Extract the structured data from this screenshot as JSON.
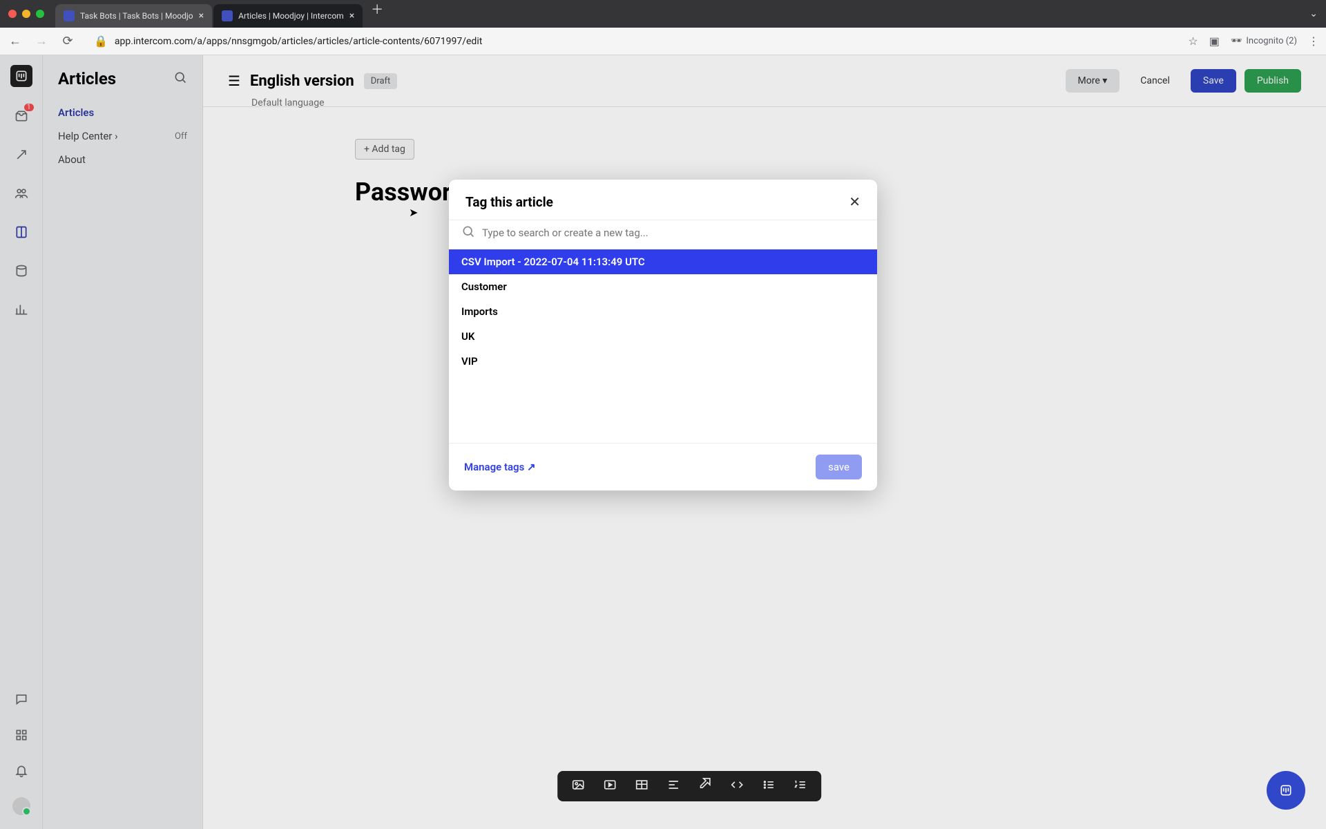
{
  "browser": {
    "tabs": [
      {
        "title": "Task Bots | Task Bots | Moodjo"
      },
      {
        "title": "Articles | Moodjoy | Intercom"
      }
    ],
    "url": "app.intercom.com/a/apps/nnsgmgob/articles/articles/article-contents/6071997/edit",
    "incognito": "Incognito (2)"
  },
  "iconbar": {
    "inbox_badge": "1"
  },
  "sidebar": {
    "title": "Articles",
    "items": [
      {
        "label": "Articles"
      },
      {
        "label": "Help Center",
        "suffix": "Off"
      },
      {
        "label": "About"
      }
    ]
  },
  "header": {
    "title": "English version",
    "badge": "Draft",
    "subtitle": "Default language",
    "more": "More",
    "cancel": "Cancel",
    "save": "Save",
    "publish": "Publish"
  },
  "body": {
    "add_tag": "+ Add tag",
    "article_title": "Password reset"
  },
  "modal": {
    "title": "Tag this article",
    "search_placeholder": "Type to search or create a new tag...",
    "tags": [
      "CSV Import - 2022-07-04 11:13:49 UTC",
      "Customer",
      "Imports",
      "UK",
      "VIP"
    ],
    "manage": "Manage tags ↗",
    "save": "save"
  }
}
